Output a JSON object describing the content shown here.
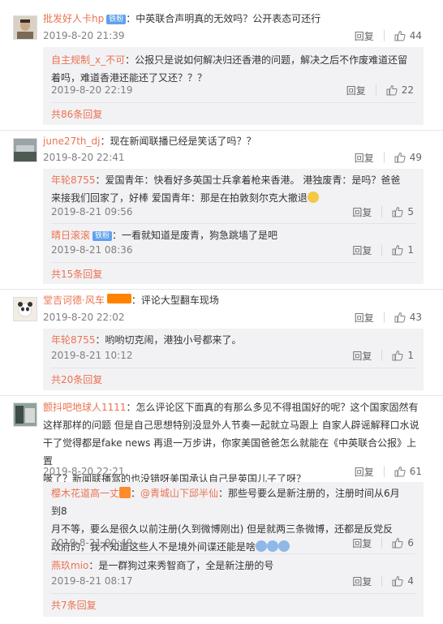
{
  "ui": {
    "reply_label": "回复",
    "colors": {
      "name": "#eb7350",
      "muted": "#808080",
      "sub_bg": "#f2f2f5",
      "badge_blue": "#5fa2ec"
    }
  },
  "comments": [
    {
      "user": "批发好人卡hp",
      "badge": "铁粉",
      "text": "：中英联合声明真的无效吗？公开表态可还行",
      "time": "2019-8-20 21:39",
      "likes": "44",
      "replies": [
        {
          "user": "自主规制_x_不可",
          "text_line1": "：公报只是说如何解决归还香港的问题，解决之后不作废难道还留",
          "text_line2": "着吗，难道香港还能还了又还？？？",
          "time": "2019-8-20 22:19",
          "likes": "22"
        }
      ],
      "more": "共86条回复"
    },
    {
      "user": "june27th_dj",
      "text": "：现在新闻联播已经是笑话了吗？？",
      "time": "2019-8-20 22:41",
      "likes": "49",
      "replies": [
        {
          "user": "年轮8755",
          "text_line1": "：爱国青年：快看好多英国士兵拿着枪来香港。     港独废青：是吗？爸爸",
          "text_line2": "来接我们回家了，好棒     爱国青年：那是在拍敦刻尔克大撤退",
          "time": "2019-8-21 09:56",
          "likes": "5"
        },
        {
          "user": "晴日滚滚",
          "badge": "铁粉",
          "text_line1": "：一看就知道是废青，狗急跳墙了是吧",
          "time": "2019-8-21 08:36",
          "likes": "1"
        }
      ],
      "more": "共15条回复"
    },
    {
      "user": "堂吉诃德·风车",
      "text": "：评论大型翻车现场",
      "time": "2019-8-20 22:02",
      "likes": "43",
      "replies": [
        {
          "user": "年轮8755",
          "text_line1": "：哟哟切克闹，港独小号都来了。",
          "time": "2019-8-21 10:12",
          "likes": "1"
        }
      ],
      "more": "共20条回复"
    },
    {
      "user": "颤抖吧地球人1111",
      "text_line1": "：怎么评论区下面真的有那么多见不得祖国好的呢？这个国家固然有",
      "text_line2": "这样那样的问题 但是自己思想特别没显外人节奏一起就立马跟上 自家人辟谣解释口水说",
      "text_line3": "干了觉得都是fake news 再退一万步讲，你家美国爸爸怎么就能在《中英联合公报》上置",
      "text_line4": "喙了？新闻联播驾的也没错呀美国承认自己是英国儿子了呀？",
      "time": "2019-8-20 22:21",
      "likes": "61",
      "replies": [
        {
          "user": "樱木花道高一丈",
          "mention": "@青城山下邱半仙",
          "text_line1": "：那些号要么是新注册的，注册时间从6月到8",
          "text_line2": "月不等，要么是很久以前注册(久到微博刚出) 但是就两三条微博，还都是反党反",
          "text_line3": "政府的，我不知道这些人不是境外间谍还能是啥",
          "time": "2019-8-21 00:49",
          "likes": "6"
        },
        {
          "user": "燕玖mio",
          "text_line1": "：是一群狗过来秀智商了，全是新注册的号",
          "time": "2019-8-21 08:17",
          "likes": "4"
        }
      ],
      "more": "共7条回复"
    }
  ]
}
